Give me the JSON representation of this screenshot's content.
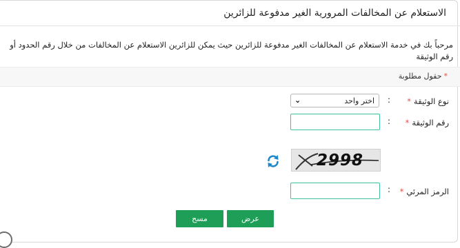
{
  "page": {
    "title": "الاستعلام عن المخالفات المرورية الغير مدفوعة للزائرين",
    "intro": "مرحباً بك في خدمة الاستعلام عن المخالفات الغير مدفوعة للزائرين حيث يمكن للزائرين الاستعلام عن المخالفات من خلال رقم الحدود أو رقم الوثيقة",
    "required_note": "حقول مطلوبة",
    "required_star": "*"
  },
  "form": {
    "doc_type_label": "نوع الوثيقة",
    "doc_type_value": "اختر واحد",
    "doc_number_label": "رقم الوثيقة",
    "doc_number_value": "",
    "captcha_text": "2998",
    "code_label": "الرمز المرئي",
    "code_value": "",
    "colon": ":"
  },
  "buttons": {
    "view": "عرض",
    "clear": "مسح"
  },
  "colors": {
    "accent_green": "#1f9e57",
    "required_red": "#d9534f",
    "refresh_blue": "#1e88c9",
    "input_border": "#3fbf9f"
  },
  "icons": {
    "refresh": "refresh-icon",
    "dropdown": "chevron-down-icon"
  }
}
